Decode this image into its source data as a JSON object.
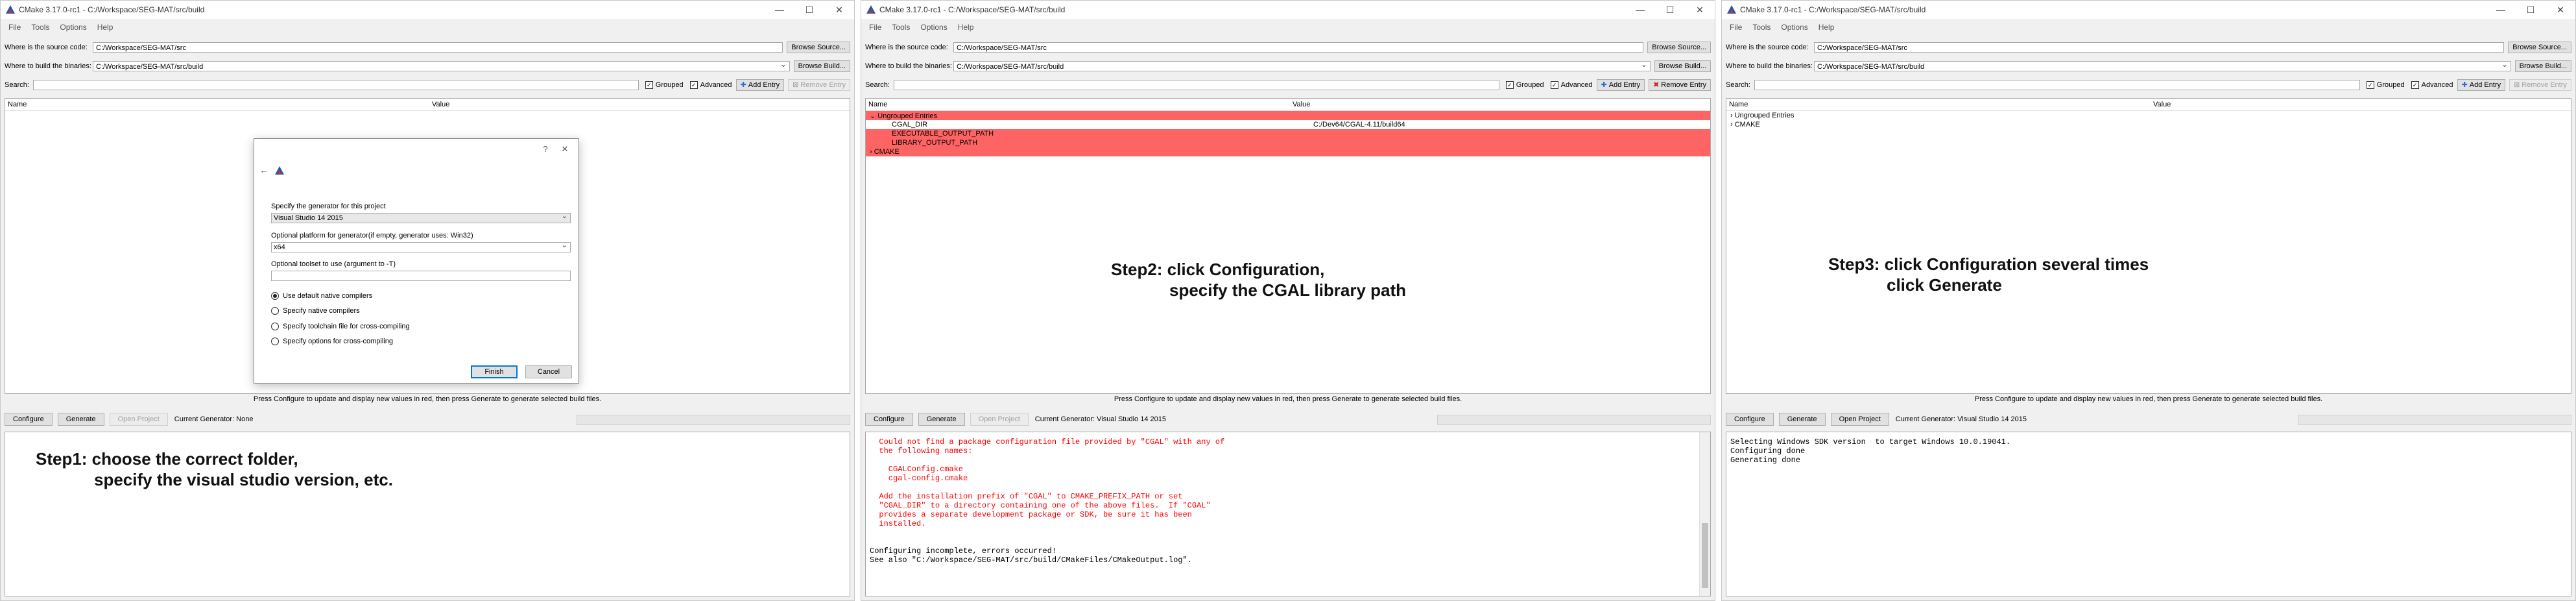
{
  "menu": [
    "File",
    "Tools",
    "Options",
    "Help"
  ],
  "labels": {
    "source": "Where is the source code:",
    "binaries": "Where to build the binaries:",
    "search": "Search:",
    "grouped": "Grouped",
    "advanced": "Advanced",
    "add_entry": "Add Entry",
    "remove_entry": "Remove Entry",
    "browse_source": "Browse Source...",
    "browse_build": "Browse Build...",
    "col_name": "Name",
    "col_value": "Value",
    "status": "Press Configure to update and display new values in red, then press Generate to generate selected build files.",
    "configure": "Configure",
    "generate": "Generate",
    "open_project": "Open Project"
  },
  "windows": [
    {
      "title": "CMake 3.17.0-rc1 - C:/Workspace/SEG-MAT/src/build",
      "source_path": "C:/Workspace/SEG-MAT/src",
      "build_path": "C:/Workspace/SEG-MAT/src/build",
      "current_generator": "Current Generator: None",
      "step": [
        "Step1: choose the correct folder,",
        "specify the visual studio version, etc."
      ]
    },
    {
      "title": "CMake 3.17.0-rc1 - C:/Workspace/SEG-MAT/src/build",
      "source_path": "C:/Workspace/SEG-MAT/src",
      "build_path": "C:/Workspace/SEG-MAT/src/build",
      "current_generator": "Current Generator: Visual Studio 14 2015",
      "step": [
        "Step2: click Configuration,",
        "specify the CGAL library path"
      ],
      "tree": [
        {
          "name": "⌄  Ungrouped Entries",
          "value": "",
          "red": true
        },
        {
          "name": "CGAL_DIR",
          "value": "C:/Dev64/CGAL-4.11/build64",
          "red": false
        },
        {
          "name": "EXECUTABLE_OUTPUT_PATH",
          "value": "",
          "red": true
        },
        {
          "name": "LIBRARY_OUTPUT_PATH",
          "value": "",
          "red": true
        },
        {
          "name": "›  CMAKE",
          "value": "",
          "red": true
        }
      ],
      "output": [
        {
          "text": "  Could not find a package configuration file provided by \"CGAL\" with any of",
          "err": true
        },
        {
          "text": "  the following names:",
          "err": true
        },
        {
          "text": "",
          "err": true
        },
        {
          "text": "    CGALConfig.cmake",
          "err": true
        },
        {
          "text": "    cgal-config.cmake",
          "err": true
        },
        {
          "text": "",
          "err": true
        },
        {
          "text": "  Add the installation prefix of \"CGAL\" to CMAKE_PREFIX_PATH or set",
          "err": true
        },
        {
          "text": "  \"CGAL_DIR\" to a directory containing one of the above files.  If \"CGAL\"",
          "err": true
        },
        {
          "text": "  provides a separate development package or SDK, be sure it has been",
          "err": true
        },
        {
          "text": "  installed.",
          "err": true
        },
        {
          "text": "",
          "err": false
        },
        {
          "text": "",
          "err": false
        },
        {
          "text": "Configuring incomplete, errors occurred!",
          "err": false
        },
        {
          "text": "See also \"C:/Workspace/SEG-MAT/src/build/CMakeFiles/CMakeOutput.log\".",
          "err": false
        }
      ]
    },
    {
      "title": "CMake 3.17.0-rc1 - C:/Workspace/SEG-MAT/src/build",
      "source_path": "C:/Workspace/SEG-MAT/src",
      "build_path": "C:/Workspace/SEG-MAT/src/build",
      "current_generator": "Current Generator: Visual Studio 14 2015",
      "step": [
        "Step3: click Configuration several times",
        "click Generate"
      ],
      "tree": [
        {
          "name": "›  Ungrouped Entries",
          "value": "",
          "red": false
        },
        {
          "name": "›  CMAKE",
          "value": "",
          "red": false
        }
      ],
      "output": [
        {
          "text": "Selecting Windows SDK version  to target Windows 10.0.19041.",
          "err": false
        },
        {
          "text": "Configuring done",
          "err": false
        },
        {
          "text": "Generating done",
          "err": false
        }
      ]
    }
  ],
  "dialog": {
    "gen_label": "Specify the generator for this project",
    "gen_value": "Visual Studio 14 2015",
    "platform_label": "Optional platform for generator(if empty, generator uses: Win32)",
    "platform_value": "x64",
    "toolset_label": "Optional toolset to use (argument to -T)",
    "toolset_value": "",
    "options": [
      "Use default native compilers",
      "Specify native compilers",
      "Specify toolchain file for cross-compiling",
      "Specify options for cross-compiling"
    ],
    "finish": "Finish",
    "cancel": "Cancel"
  },
  "colors": {
    "error_red": "#ff6464",
    "error_text": "#ff0000"
  }
}
